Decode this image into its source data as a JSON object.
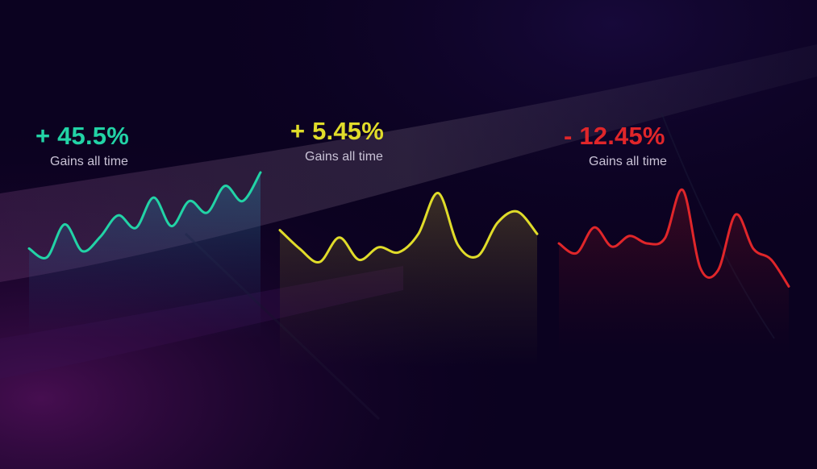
{
  "colors": {
    "background": "#0b0220",
    "series_1": "#22d3a6",
    "series_2": "#e0dc2a",
    "series_3": "#e0262a"
  },
  "cards": [
    {
      "value": "+ 45.5%",
      "label": "Gains all time"
    },
    {
      "value": "+ 5.45%",
      "label": "Gains all time"
    },
    {
      "value": "- 12.45%",
      "label": "Gains all time"
    }
  ],
  "chart_data": [
    {
      "type": "area",
      "series": [
        {
          "color": "#22d3a6",
          "values": [
            0.15,
            0.05,
            0.42,
            0.12,
            0.28,
            0.52,
            0.38,
            0.72,
            0.4,
            0.68,
            0.55,
            0.85,
            0.68,
            1.0
          ]
        }
      ]
    },
    {
      "type": "area",
      "series": [
        {
          "color": "#e0dc2a",
          "values": [
            0.45,
            0.2,
            0.02,
            0.35,
            0.05,
            0.22,
            0.15,
            0.4,
            0.95,
            0.25,
            0.1,
            0.55,
            0.7,
            0.4
          ]
        }
      ]
    },
    {
      "type": "area",
      "series": [
        {
          "color": "#e0262a",
          "values": [
            0.45,
            0.36,
            0.6,
            0.42,
            0.52,
            0.45,
            0.5,
            0.95,
            0.22,
            0.2,
            0.72,
            0.4,
            0.3,
            0.05
          ]
        }
      ]
    }
  ]
}
